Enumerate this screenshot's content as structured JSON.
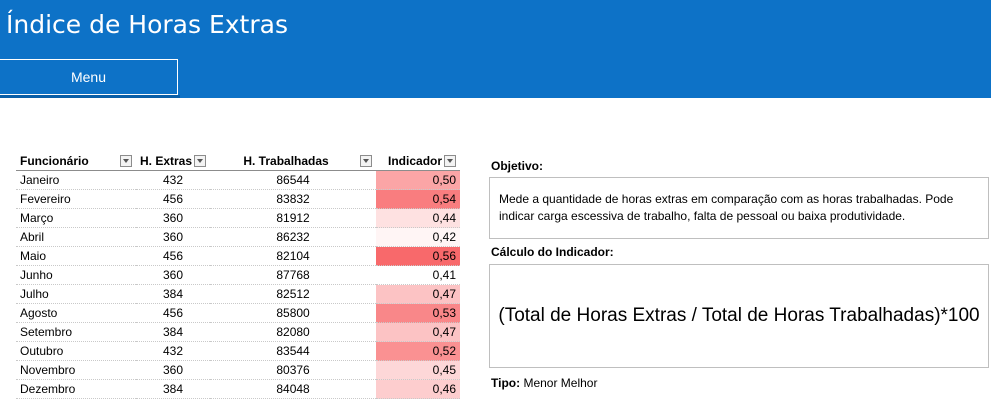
{
  "header": {
    "title": "Índice de Horas Extras",
    "menu_label": "Menu"
  },
  "table": {
    "columns": [
      "Funcionário",
      "H. Extras",
      "H. Trabalhadas",
      "Indicador"
    ],
    "rows": [
      {
        "name": "Janeiro",
        "extras": "432",
        "trabalhadas": "86544",
        "indicador": "0,50",
        "heat": 0.5
      },
      {
        "name": "Fevereiro",
        "extras": "456",
        "trabalhadas": "83832",
        "indicador": "0,54",
        "heat": 0.54
      },
      {
        "name": "Março",
        "extras": "360",
        "trabalhadas": "81912",
        "indicador": "0,44",
        "heat": 0.44
      },
      {
        "name": "Abril",
        "extras": "360",
        "trabalhadas": "86232",
        "indicador": "0,42",
        "heat": 0.42
      },
      {
        "name": "Maio",
        "extras": "456",
        "trabalhadas": "82104",
        "indicador": "0,56",
        "heat": 0.56
      },
      {
        "name": "Junho",
        "extras": "360",
        "trabalhadas": "87768",
        "indicador": "0,41",
        "heat": 0.41
      },
      {
        "name": "Julho",
        "extras": "384",
        "trabalhadas": "82512",
        "indicador": "0,47",
        "heat": 0.47
      },
      {
        "name": "Agosto",
        "extras": "456",
        "trabalhadas": "85800",
        "indicador": "0,53",
        "heat": 0.53
      },
      {
        "name": "Setembro",
        "extras": "384",
        "trabalhadas": "82080",
        "indicador": "0,47",
        "heat": 0.47
      },
      {
        "name": "Outubro",
        "extras": "432",
        "trabalhadas": "83544",
        "indicador": "0,52",
        "heat": 0.52
      },
      {
        "name": "Novembro",
        "extras": "360",
        "trabalhadas": "80376",
        "indicador": "0,45",
        "heat": 0.45
      },
      {
        "name": "Dezembro",
        "extras": "384",
        "trabalhadas": "84048",
        "indicador": "0,46",
        "heat": 0.46
      }
    ],
    "heat_min": 0.41,
    "heat_max": 0.56,
    "heat_color_low": "#ffffff",
    "heat_color_high": "#f8696b"
  },
  "info": {
    "objetivo_label": "Objetivo:",
    "objetivo_text": "Mede a quantidade de horas extras em comparação com as horas trabalhadas. Pode indicar carga escessiva de trabalho, falta de pessoal ou baixa produtividade.",
    "calculo_label": "Cálculo do Indicador:",
    "formula": "(Total de Horas Extras / Total de Horas Trabalhadas)*100",
    "tipo_label": "Tipo:",
    "tipo_value": "Menor Melhor"
  },
  "colors": {
    "header_bg": "#0d72c7"
  }
}
